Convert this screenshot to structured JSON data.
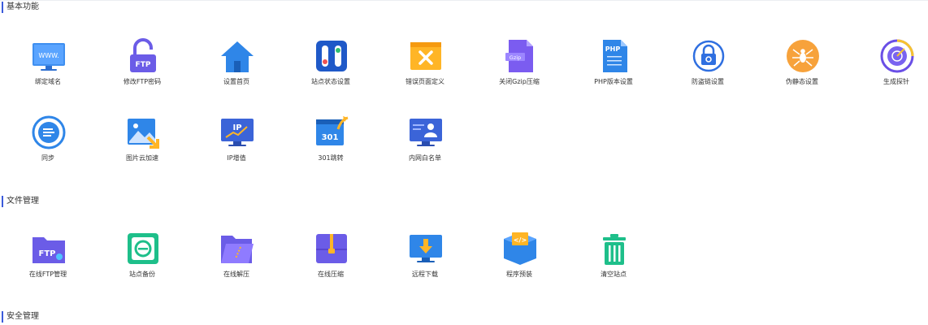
{
  "sections": [
    {
      "title": "基本功能",
      "items": [
        {
          "label": "绑定域名",
          "icon": "www-monitor-icon"
        },
        {
          "label": "修改FTP密码",
          "icon": "ftp-lock-icon"
        },
        {
          "label": "设置首页",
          "icon": "home-icon"
        },
        {
          "label": "站点状态设置",
          "icon": "status-toggle-icon"
        },
        {
          "label": "错误页面定义",
          "icon": "error-page-icon"
        },
        {
          "label": "关闭Gzip压缩",
          "icon": "gzip-file-icon"
        },
        {
          "label": "PHP版本设置",
          "icon": "php-file-icon"
        },
        {
          "label": "防盗链设置",
          "icon": "anti-leech-icon"
        },
        {
          "label": "伪静态设置",
          "icon": "spider-icon"
        },
        {
          "label": "生成探针",
          "icon": "probe-radar-icon"
        },
        {
          "label": "同步",
          "icon": "sync-icon"
        },
        {
          "label": "图片云加速",
          "icon": "image-cloud-icon"
        },
        {
          "label": "IP增值",
          "icon": "ip-growth-icon"
        },
        {
          "label": "301跳转",
          "icon": "redirect-301-icon"
        },
        {
          "label": "内网白名单",
          "icon": "whitelist-user-icon"
        }
      ]
    },
    {
      "title": "文件管理",
      "items": [
        {
          "label": "在线FTP管理",
          "icon": "ftp-folder-icon"
        },
        {
          "label": "站点备份",
          "icon": "backup-icon"
        },
        {
          "label": "在线解压",
          "icon": "unzip-folder-icon"
        },
        {
          "label": "在线压缩",
          "icon": "zip-box-icon"
        },
        {
          "label": "远程下载",
          "icon": "download-monitor-icon"
        },
        {
          "label": "程序预装",
          "icon": "code-box-icon"
        },
        {
          "label": "清空站点",
          "icon": "trash-icon"
        }
      ]
    },
    {
      "title": "安全管理",
      "items": []
    }
  ],
  "icon_text": {
    "www": "WWW.",
    "ftp": "FTP",
    "gzip": "Gzip",
    "php": "PHP",
    "ip": "IP",
    "r301": "301",
    "code": "</>"
  }
}
